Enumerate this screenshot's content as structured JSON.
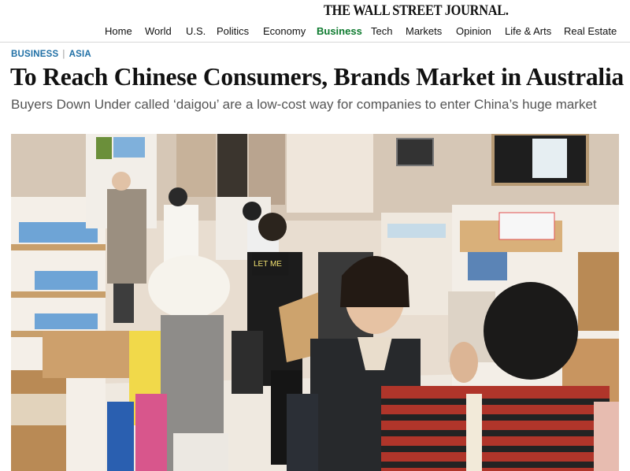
{
  "masthead": {
    "logo": "THE WALL STREET JOURNAL."
  },
  "nav": {
    "items": [
      {
        "label": "Home"
      },
      {
        "label": "World"
      },
      {
        "label": "U.S."
      },
      {
        "label": "Politics"
      },
      {
        "label": "Economy"
      },
      {
        "label": "Business"
      },
      {
        "label": "Tech"
      },
      {
        "label": "Markets"
      },
      {
        "label": "Opinion"
      },
      {
        "label": "Life & Arts"
      },
      {
        "label": "Real Estate"
      }
    ],
    "active": "Business"
  },
  "article": {
    "section": "BUSINESS",
    "subsection": "ASIA",
    "headline": "To Reach Chinese Consumers, Brands Market in Australia",
    "dek": "Buyers Down Under called ‘daigou’ are a low-cost way for companies to enter China’s huge market",
    "photo": {
      "tshirt_text": "LET ME"
    }
  },
  "colors": {
    "accent_nav": "#0d7a2e",
    "kicker": "#1f6fa5"
  }
}
